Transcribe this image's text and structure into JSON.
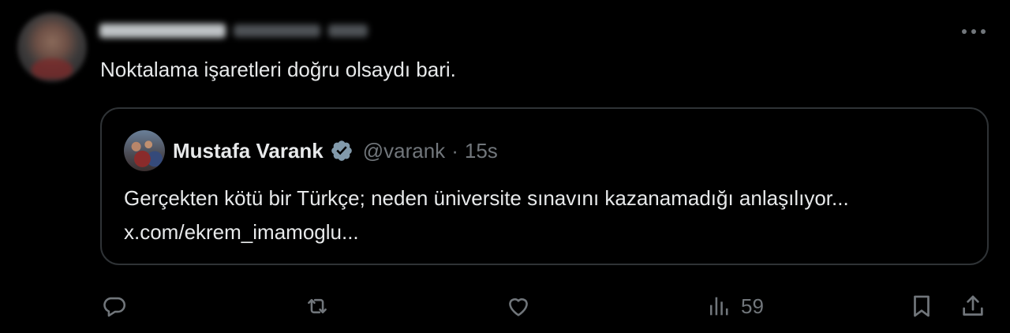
{
  "tweet": {
    "text": "Noktalama işaretleri doğru olsaydı bari."
  },
  "quoted": {
    "name": "Mustafa Varank",
    "handle": "@varank",
    "separator": "·",
    "time": "15s",
    "text": "Gerçekten kötü bir Türkçe; neden üniversite sınavını kazanamadığı anlaşılıyor... x.com/ekrem_imamoglu..."
  },
  "actions": {
    "views_count": "59"
  },
  "icons": {
    "more": "more-horizontal-icon",
    "reply": "reply-icon",
    "retweet": "retweet-icon",
    "like": "heart-icon",
    "views": "views-icon",
    "bookmark": "bookmark-icon",
    "share": "share-icon",
    "verified": "verified-badge-icon"
  },
  "colors": {
    "background": "#000000",
    "text": "#e7e9ea",
    "secondary": "#71767b",
    "border": "#2f3336",
    "verified_badge": "#829aab"
  }
}
